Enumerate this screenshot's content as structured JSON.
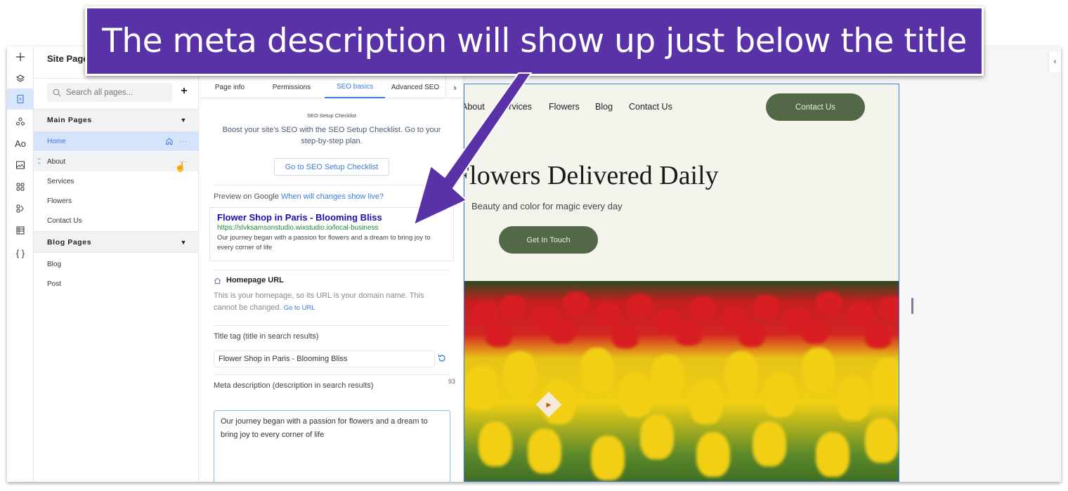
{
  "annotation": {
    "callout_text": "The meta description will show up just below the title",
    "color": "#5a32a8"
  },
  "rail": {
    "items": [
      {
        "name": "add",
        "icon": "plus-icon"
      },
      {
        "name": "layers",
        "icon": "layers-icon"
      },
      {
        "name": "pages",
        "icon": "page-icon",
        "active": true
      },
      {
        "name": "components",
        "icon": "components-icon"
      },
      {
        "name": "theme",
        "icon": "typography-icon"
      },
      {
        "name": "media",
        "icon": "image-icon"
      },
      {
        "name": "apps",
        "icon": "apps-grid-icon"
      },
      {
        "name": "business-apps",
        "icon": "business-apps-icon"
      },
      {
        "name": "cms",
        "icon": "table-icon"
      },
      {
        "name": "code",
        "icon": "code-braces-icon"
      }
    ]
  },
  "pages_panel": {
    "title": "Site Pages",
    "search_placeholder": "Search all pages...",
    "add_label": "+",
    "sections": [
      {
        "title": "Main Pages",
        "pages": [
          {
            "label": "Home",
            "selected": true,
            "is_home": true
          },
          {
            "label": "About",
            "hover": true
          },
          {
            "label": "Services"
          },
          {
            "label": "Flowers"
          },
          {
            "label": "Contact Us"
          }
        ]
      },
      {
        "title": "Blog Pages",
        "pages": [
          {
            "label": "Blog"
          },
          {
            "label": "Post"
          }
        ]
      }
    ],
    "more_label": "···",
    "drag_label": "⁚⁚"
  },
  "settings": {
    "tabs": [
      {
        "label": "Page info"
      },
      {
        "label": "Permissions"
      },
      {
        "label": "SEO basics",
        "active": true
      },
      {
        "label": "Advanced SEO"
      }
    ],
    "tabs_next": "›",
    "checklist": {
      "title": "SEO Setup Checklist",
      "description": "Boost your site's SEO with the SEO Setup Checklist. Go to your step-by-step plan.",
      "button": "Go to SEO Setup Checklist"
    },
    "preview": {
      "label": "Preview on Google",
      "link": "When will changes show live?",
      "google_title": "Flower Shop in Paris - Blooming Bliss",
      "google_url": "https://slvksamsonstudio.wixstudio.io/local-business",
      "google_description": "Our journey began with a passion for flowers and a dream to bring joy to every corner of life"
    },
    "homepage_url": {
      "title": "Homepage URL",
      "description": "This is your homepage, so its URL is your domain name. This cannot be changed.",
      "link": "Go to URL"
    },
    "title_tag": {
      "label": "Title tag (title in search results)",
      "value": "Flower Shop in Paris - Blooming Bliss"
    },
    "meta_description": {
      "label": "Meta description (description in search results)",
      "char_count": "93",
      "value": "Our journey began with a passion for flowers and a dream to bring joy to every corner of life"
    }
  },
  "site_preview": {
    "nav": [
      "About",
      "Services",
      "Flowers",
      "Blog",
      "Contact Us"
    ],
    "nav_cta": "Contact Us",
    "hero_title": "Flowers Delivered Daily",
    "hero_subtitle": "Beauty and color for magic every day",
    "hero_cta": "Get In Touch",
    "brand_color": "#536846",
    "background_color": "#f4f3ec"
  },
  "right_panel": {
    "collapse_label": "‹"
  }
}
